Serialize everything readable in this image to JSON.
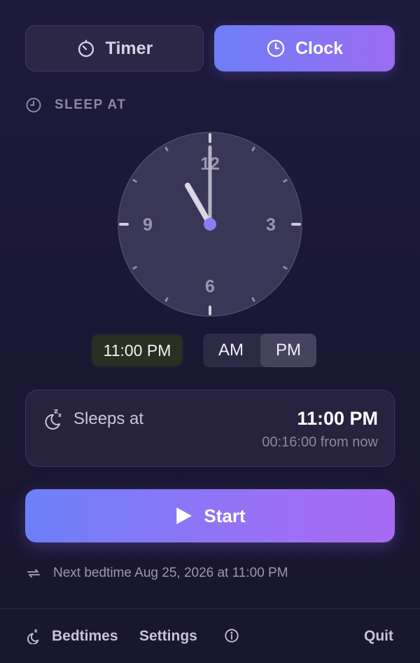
{
  "mode_toggle": {
    "timer_label": "Timer",
    "clock_label": "Clock",
    "selected": "Clock"
  },
  "section": {
    "label": "SLEEP AT"
  },
  "clock": {
    "numbers": [
      "12",
      "3",
      "6",
      "9"
    ],
    "hour": 11,
    "minute": 0,
    "accent": "#8b7cf6"
  },
  "time_input": {
    "value": "11:00 PM"
  },
  "ampm": {
    "am_label": "AM",
    "pm_label": "PM",
    "selected": "PM"
  },
  "sleep_card": {
    "label": "Sleeps at",
    "time": "11:00 PM",
    "countdown": "00:16:00 from now"
  },
  "start_button": {
    "label": "Start"
  },
  "next_bedtime": {
    "text": "Next bedtime Aug 25, 2026 at 11:00 PM"
  },
  "footer": {
    "bedtimes_label": "Bedtimes",
    "settings_label": "Settings",
    "quit_label": "Quit"
  },
  "colors": {
    "background": "#1e1a3c",
    "gradient_start": "#6d7ef6",
    "gradient_end": "#a56bf2"
  },
  "icons": {
    "timer": "stopwatch-icon",
    "clock": "clock-icon",
    "sleep": "moon-zzz-icon",
    "play": "play-icon",
    "repeat": "repeat-icon",
    "info": "info-icon"
  }
}
